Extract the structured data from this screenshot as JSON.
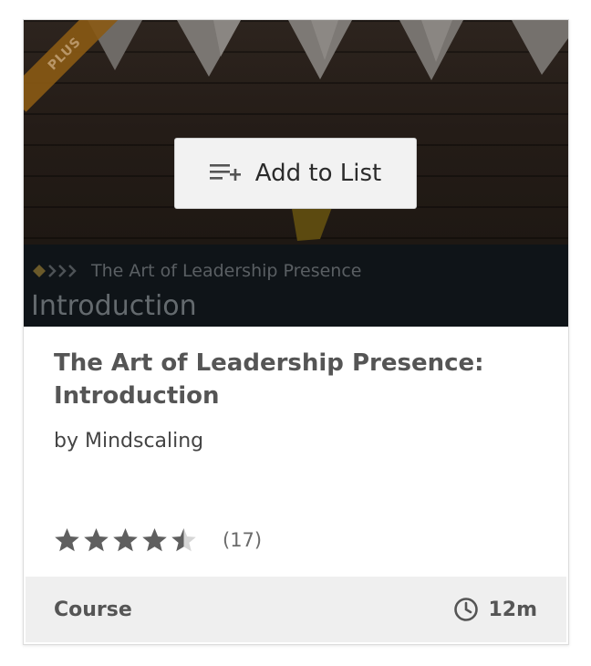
{
  "thumbnail": {
    "ribbon_label": "PLUS",
    "subtitle_line": "The Art of Leadership Presence",
    "big_label": "Introduction"
  },
  "add_button": {
    "label": "Add to List",
    "icon": "playlist-add-icon"
  },
  "course": {
    "title": "The Art of Leadership Presence: Introduction",
    "author": "by Mindscaling",
    "rating_value": 4.5,
    "rating_count": "(17)",
    "type": "Course",
    "duration": "12m"
  },
  "colors": {
    "star": "#5f5f5f",
    "star_empty": "#d6d6d6",
    "footer_bg": "#efefef",
    "ribbon": "#8a5a14"
  }
}
